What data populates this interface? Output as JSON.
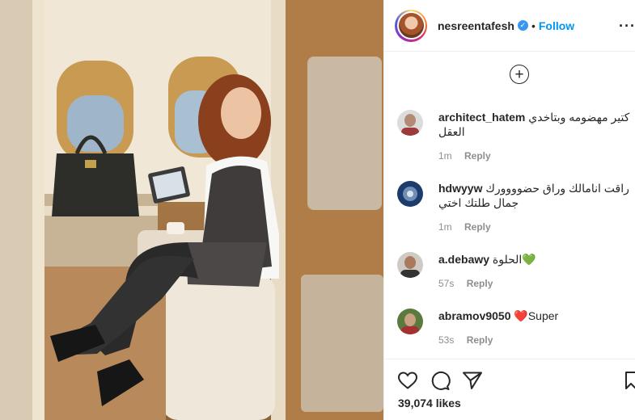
{
  "post": {
    "username": "nesreentafesh",
    "follow_label": "Follow",
    "separator": "•",
    "more_label": "…"
  },
  "icons": {
    "verified": "verified-badge-icon",
    "more": "more-options-icon",
    "load_more": "plus-circle-icon",
    "like": "heart-icon",
    "comment": "comment-bubble-icon",
    "share": "paper-plane-icon",
    "save": "bookmark-icon"
  },
  "comments": [
    {
      "user": "architect_hatem",
      "text": "كتير مهضومه وبتاخدي العقل",
      "time": "1m",
      "reply": "Reply"
    },
    {
      "user": "hdwyyw",
      "text": "راقت انامالك وراق حضوووورك جمال طلتك اختي",
      "time": "1m",
      "reply": "Reply"
    },
    {
      "user": "a.debawy",
      "text": "الحلوة",
      "emoji": "💚",
      "time": "57s",
      "reply": "Reply"
    },
    {
      "user": "abramov9050",
      "emoji": "❤️",
      "text": "Super",
      "time": "53s",
      "reply": "Reply"
    }
  ],
  "likes_label": "39,074 likes",
  "colors": {
    "link": "#0095f6",
    "text": "#262626",
    "muted": "#8e8e8e",
    "border": "#efefef"
  }
}
